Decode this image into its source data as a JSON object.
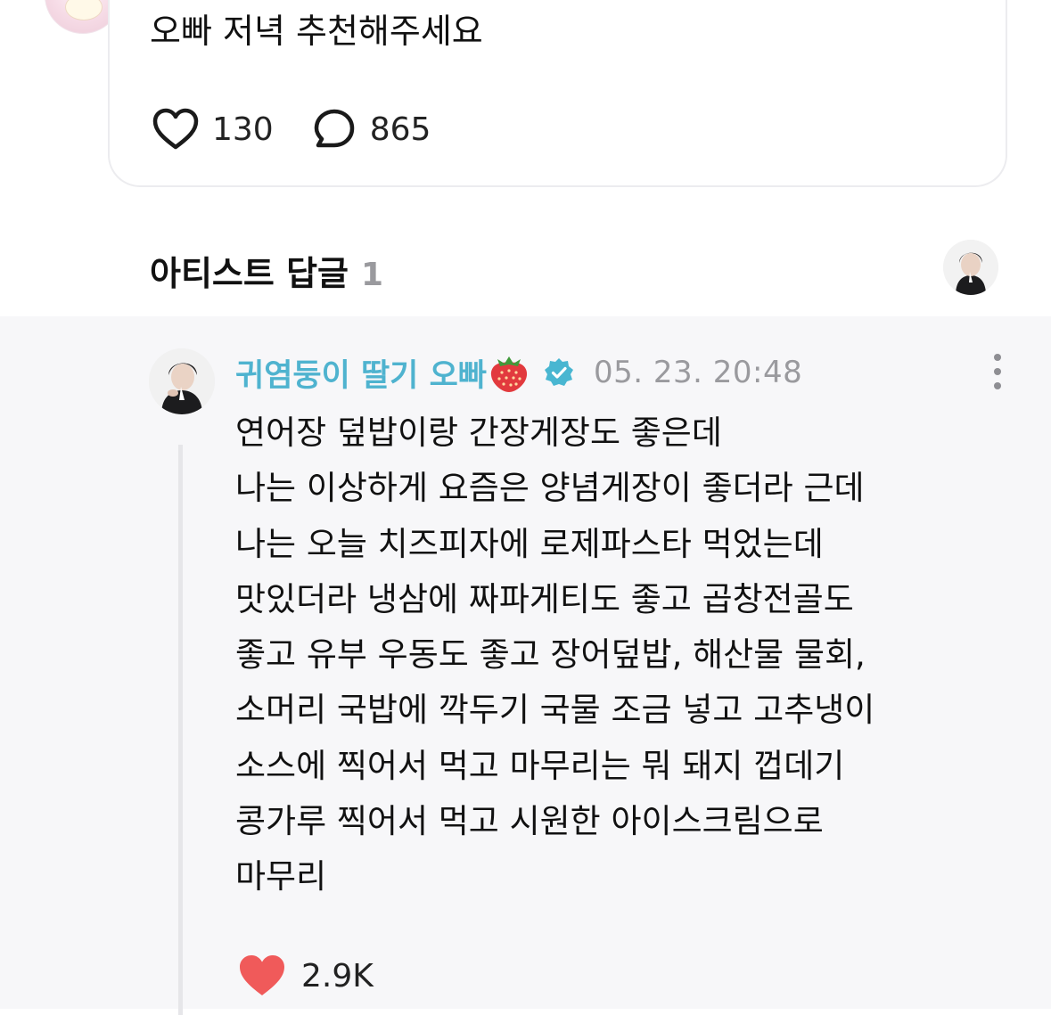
{
  "post": {
    "text": "오빠 저녁 추천해주세요",
    "likes": "130",
    "comments": "865"
  },
  "artist_reply_header": {
    "title": "아티스트 답글",
    "count": "1"
  },
  "reply": {
    "author": "귀염둥이 딸기 오빠",
    "author_emoji": "strawberry-icon",
    "verified_icon": "verified-badge-icon",
    "timestamp": "05. 23. 20:48",
    "lines": [
      "연어장 덮밥이랑 간장게장도 좋은데",
      "나는 이상하게 요즘은 양념게장이 좋더라 근데",
      "나는 오늘 치즈피자에 로제파스타 먹었는데",
      "맛있더라 냉삼에 짜파게티도 좋고 곱창전골도",
      "좋고 유부 우동도 좋고 장어덮밥, 해산물 물회,",
      "소머리 국밥에 깍두기 국물 조금 넣고 고추냉이",
      "소스에 찍어서 먹고 마무리는 뭐 돼지 껍데기",
      "콩가루 찍어서 먹고 시원한 아이스크림으로",
      "마무리"
    ],
    "likes": "2.9K"
  },
  "colors": {
    "author_name": "#4fb3cf",
    "verified_badge": "#49b6d1",
    "liked_heart": "#f05a5a",
    "reply_background": "#f7f7f9",
    "muted_text": "#9a9a9e"
  }
}
